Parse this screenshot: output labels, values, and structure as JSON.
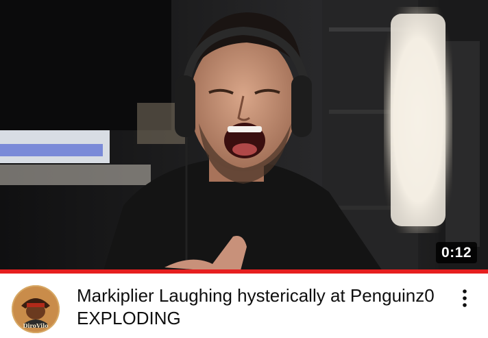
{
  "video": {
    "title": "Markiplier Laughing hysterically at Penguinz0 EXPLODING",
    "duration": "0:12",
    "watch_progress": 1.0,
    "progress_color": "#e61f1f"
  },
  "channel": {
    "avatar_text": "DiroVilo",
    "avatar_icon": "channel-avatar-icon"
  },
  "actions": {
    "menu_icon": "more-vert-icon"
  }
}
